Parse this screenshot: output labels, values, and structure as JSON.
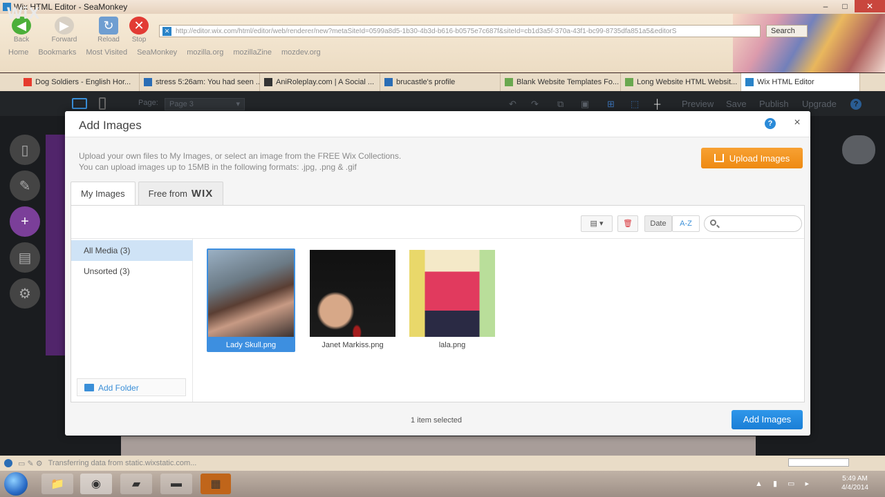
{
  "window": {
    "title": "Wix HTML Editor - SeaMonkey",
    "buttons": [
      "–",
      "□",
      "✕"
    ]
  },
  "browser": {
    "nav": {
      "back": "Back",
      "forward": "Forward",
      "reload": "Reload",
      "stop": "Stop"
    },
    "url": "http://editor.wix.com/html/editor/web/renderer/new?metaSiteId=0599a8d5-1b30-4b3d-b616-b0575e7c687f&siteId=cb1d3a5f-370a-43f1-bc99-8735dfa851a5&editorS",
    "search_label": "Search",
    "bookmarks": [
      "Home",
      "Bookmarks",
      "Most Visited",
      "SeaMonkey",
      "mozilla.org",
      "mozillaZine",
      "mozdev.org"
    ],
    "tabs": [
      {
        "label": "Dog Soldiers - English Hor...",
        "color": "#e63b2e"
      },
      {
        "label": "stress 5:26am: You had seen ...",
        "color": "#2a6db5"
      },
      {
        "label": "AniRoleplay.com | A Social ...",
        "color": "#333333"
      },
      {
        "label": "brucastle's profile",
        "color": "#2a6db5"
      },
      {
        "label": "Blank Website Templates Fo...",
        "color": "#6aa84f"
      },
      {
        "label": "Long Website HTML Websit...",
        "color": "#6aa84f"
      },
      {
        "label": "Wix HTML Editor",
        "color": "#2a83c8"
      }
    ],
    "status": "Transferring data from static.wixstatic.com..."
  },
  "wix": {
    "logo": "WiX",
    "page_label": "Page:",
    "page_value": "Page 3",
    "menu": [
      "Preview",
      "Save",
      "Publish",
      "Upgrade"
    ]
  },
  "dialog": {
    "title": "Add Images",
    "help": "?",
    "close": "×",
    "intro_line1": "Upload your own files to My Images, or select an image from the FREE Wix Collections.",
    "intro_line2": "You can upload images up to 15MB in the following formats: .jpg, .png & .gif",
    "upload_label": "Upload Images",
    "tab_my_images": "My Images",
    "tab_free_from": "Free from",
    "tab_free_brand": "WIX",
    "sort_date": "Date",
    "sort_az": "A-Z",
    "sidebar": [
      {
        "label": "All Media (3)"
      },
      {
        "label": "Unsorted (3)"
      }
    ],
    "add_folder": "Add Folder",
    "images": [
      {
        "name": "Lady Skull.png",
        "selected": true
      },
      {
        "name": "Janet Markiss.png",
        "selected": false
      },
      {
        "name": "lala.png",
        "selected": false
      }
    ],
    "selection_status": "1 item selected",
    "add_images_label": "Add Images"
  },
  "taskbar": {
    "time": "5:49 AM",
    "date": "4/4/2014"
  }
}
